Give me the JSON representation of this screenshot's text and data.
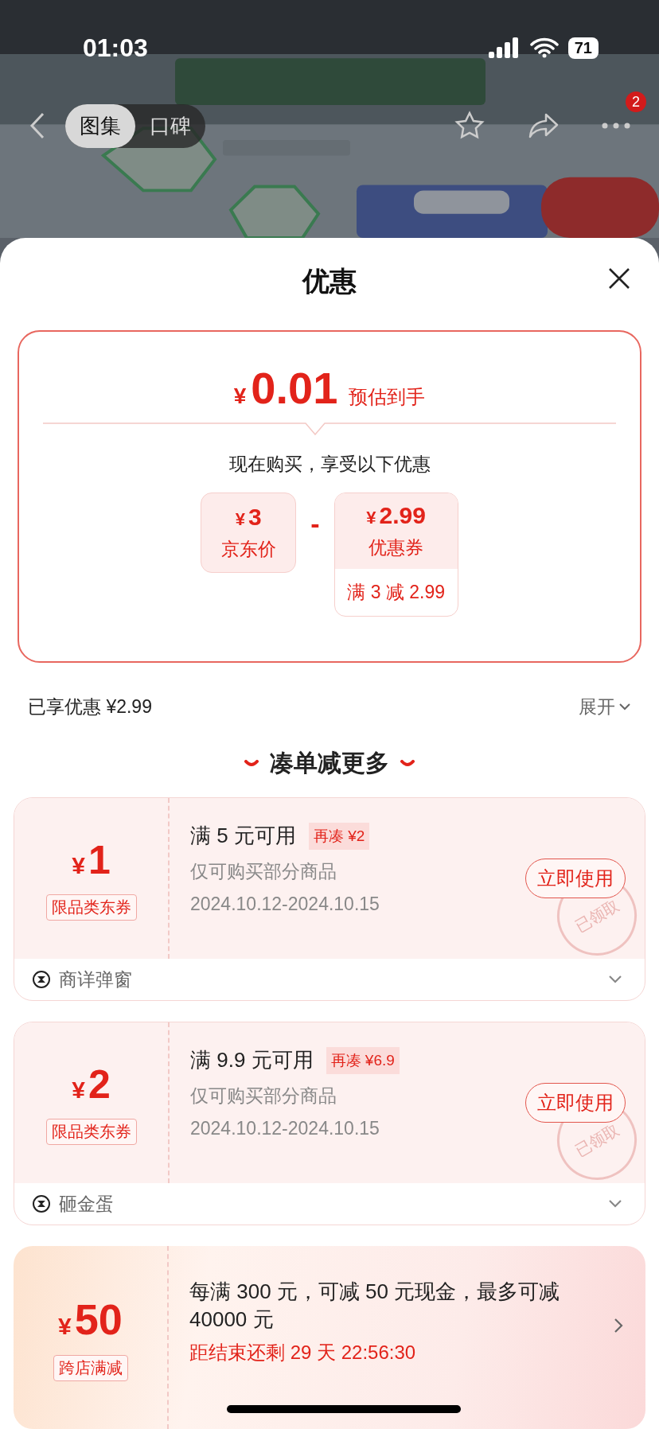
{
  "status_bar": {
    "time": "01:03",
    "battery": "71"
  },
  "nav": {
    "tabs": [
      {
        "label": "图集",
        "selected": true
      },
      {
        "label": "口碑",
        "selected": false
      }
    ],
    "more_badge": "2"
  },
  "sheet": {
    "title": "优惠",
    "summary": {
      "currency": "¥",
      "amount": "0.01",
      "caption": "预估到手",
      "intro": "现在购买，享受以下优惠",
      "price": {
        "currency": "¥",
        "amount": "3",
        "label": "京东价"
      },
      "operator": "-",
      "discount": {
        "currency": "¥",
        "amount": "2.99",
        "label": "优惠券",
        "rule": "满 3 减 2.99"
      }
    },
    "enjoyed": {
      "label": "已享优惠 ¥2.99",
      "toggle": "展开"
    },
    "section_title": "凑单减更多",
    "coupons": [
      {
        "kind": "coupon",
        "currency": "¥",
        "amount": "1",
        "tag": "限品类东券",
        "condition": "满 5 元可用",
        "extra": "再凑 ¥2",
        "scope": "仅可购买部分商品",
        "validity": "2024.10.12-2024.10.15",
        "action": "立即使用",
        "stamp": "已领取",
        "source": "商详弹窗"
      },
      {
        "kind": "coupon",
        "currency": "¥",
        "amount": "2",
        "tag": "限品类东券",
        "condition": "满 9.9 元可用",
        "extra": "再凑 ¥6.9",
        "scope": "仅可购买部分商品",
        "validity": "2024.10.12-2024.10.15",
        "action": "立即使用",
        "stamp": "已领取",
        "source": "砸金蛋"
      },
      {
        "kind": "promotion",
        "currency": "¥",
        "amount": "50",
        "tag": "跨店满减",
        "condition": "每满 300 元，可减 50 元现金，最多可减 40000 元",
        "countdown": "距结束还剩 29 天 22:56:30"
      }
    ]
  }
}
